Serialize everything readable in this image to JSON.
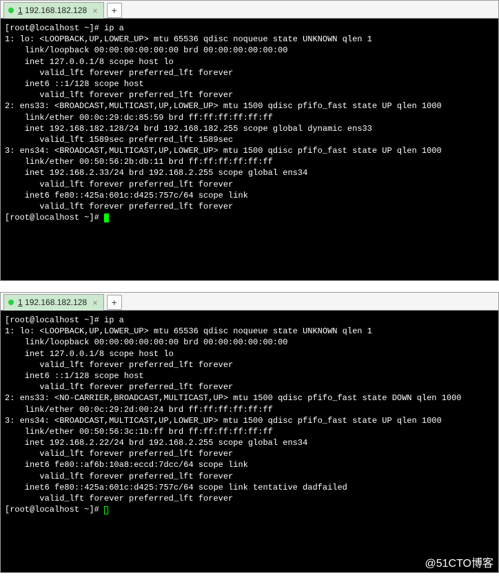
{
  "tabs": {
    "active_prefix": "1",
    "active_title": "192.168.182.128",
    "new_tab_symbol": "+",
    "close_symbol": "×"
  },
  "common": {
    "prompt_cmd": "[root@localhost ~]# ip a",
    "prompt_empty": "[root@localhost ~]# "
  },
  "top": {
    "lines": [
      "1: lo: <LOOPBACK,UP,LOWER_UP> mtu 65536 qdisc noqueue state UNKNOWN qlen 1",
      "    link/loopback 00:00:00:00:00:00 brd 00:00:00:00:00:00",
      "    inet 127.0.0.1/8 scope host lo",
      "       valid_lft forever preferred_lft forever",
      "    inet6 ::1/128 scope host",
      "       valid_lft forever preferred_lft forever",
      "2: ens33: <BROADCAST,MULTICAST,UP,LOWER_UP> mtu 1500 qdisc pfifo_fast state UP qlen 1000",
      "    link/ether 00:0c:29:dc:85:59 brd ff:ff:ff:ff:ff:ff",
      "    inet 192.168.182.128/24 brd 192.168.182.255 scope global dynamic ens33",
      "       valid_lft 1589sec preferred_lft 1589sec",
      "3: ens34: <BROADCAST,MULTICAST,UP,LOWER_UP> mtu 1500 qdisc pfifo_fast state UP qlen 1000",
      "    link/ether 00:50:56:2b:db:11 brd ff:ff:ff:ff:ff:ff",
      "    inet 192.168.2.33/24 brd 192.168.2.255 scope global ens34",
      "       valid_lft forever preferred_lft forever",
      "    inet6 fe80::425a:601c:d425:757c/64 scope link",
      "       valid_lft forever preferred_lft forever"
    ]
  },
  "bottom": {
    "lines": [
      "1: lo: <LOOPBACK,UP,LOWER_UP> mtu 65536 qdisc noqueue state UNKNOWN qlen 1",
      "    link/loopback 00:00:00:00:00:00 brd 00:00:00:00:00:00",
      "    inet 127.0.0.1/8 scope host lo",
      "       valid_lft forever preferred_lft forever",
      "    inet6 ::1/128 scope host",
      "       valid_lft forever preferred_lft forever",
      "2: ens33: <NO-CARRIER,BROADCAST,MULTICAST,UP> mtu 1500 qdisc pfifo_fast state DOWN qlen 1000",
      "    link/ether 00:0c:29:2d:00:24 brd ff:ff:ff:ff:ff:ff",
      "3: ens34: <BROADCAST,MULTICAST,UP,LOWER_UP> mtu 1500 qdisc pfifo_fast state UP qlen 1000",
      "    link/ether 00:50:56:3c:1b:ff brd ff:ff:ff:ff:ff:ff",
      "    inet 192.168.2.22/24 brd 192.168.2.255 scope global ens34",
      "       valid_lft forever preferred_lft forever",
      "    inet6 fe80::af6b:10a8:eccd:7dcc/64 scope link",
      "       valid_lft forever preferred_lft forever",
      "    inet6 fe80::425a:601c:d425:757c/64 scope link tentative dadfailed",
      "       valid_lft forever preferred_lft forever"
    ]
  },
  "watermark": "@51CTO博客"
}
